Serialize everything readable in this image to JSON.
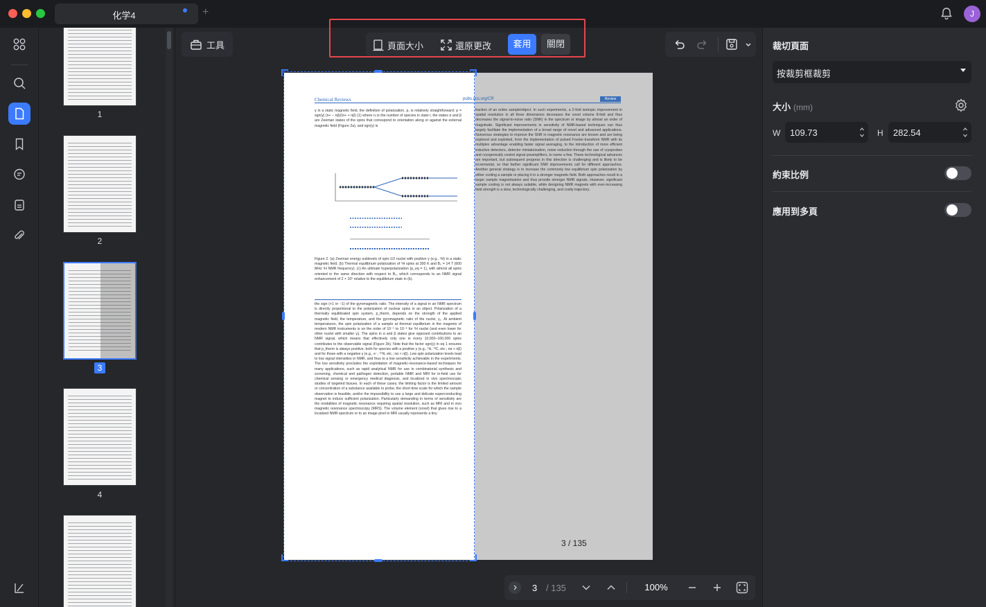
{
  "window": {
    "tab_title": "化学4",
    "tab_add": "+",
    "avatar_initial": "J"
  },
  "thumbnails": [
    {
      "label": "1",
      "selected": false
    },
    {
      "label": "2",
      "selected": false
    },
    {
      "label": "3",
      "selected": true
    },
    {
      "label": "4",
      "selected": false
    },
    {
      "label": "",
      "selected": false
    }
  ],
  "toolbar": {
    "tools_label": "工具",
    "page_size_label": "頁面大小",
    "reset_label": "還原更改",
    "apply_label": "套用",
    "close_label": "關閉"
  },
  "document": {
    "journal_name": "Chemical Reviews",
    "journal_url": "pubs.acs.org/CR",
    "badge": "Review",
    "figure_caption": "Figure 2. (a) Zeeman energy sublevels of spin-1/2 nuclei with positive γ (e.g., ¹H) in a static magnetic field. (b) Thermal equilibrium polarization of ¹H spins at 300 K and B₀ = 14 T (600 MHz ¹H NMR frequency). (c) An ultimate hyperpolarization (p_eq = 1), with almost all spins oriented in the same direction with respect to B₀, which corresponds to an NMR signal enhancement of 2 × 10⁵ relative to the equilibrium state in (b).",
    "left_col_1": "γ in a static magnetic field, the definition of polarization, p, is relatively straightforward: p = sgn(γ) (n+ − nβ)/(n+ + nβ) (1) where nᵢ is the number of species in state i; the states α and β are Zeeman states of the spins that correspond to orientation along or against the external magnetic field (Figure 2a), and sgn(γ) is",
    "left_col_2": "the sign (+1 or −1) of the gyromagnetic ratio. The intensity of a signal in an NMR spectrum is directly proportional to the polarization of nuclear spins in an object. Polarization of a thermally equilibrated spin system, p_therm, depends on the strength of the applied magnetic field, the temperature, and the gyromagnetic ratio of the nuclei, γ₁. At ambient temperatures, the spin polarization of a sample at thermal equilibrium in the magnets of modern NMR instruments is on the order of 10⁻⁵ to 10⁻⁶ for ¹H nuclei (and even lower for other nuclei with smaller γᵢ). The spins in α and β states give opposed contributions to an NMR signal, which means that effectively only one in every 10,000−100,000 spins contributes to the observable signal (Figure 2b). Note that the factor sgn(γ) in eq 1 ensures that p_therm is always positive, both for species with a positive γ (e.g., ¹H, ¹³C, etc.; nα > nβ) and for those with a negative γ (e.g., e⁻, ¹⁵N, etc.; nα < nβ). Low spin polarization levels lead to low signal intensities in NMR, and thus to a low sensitivity achievable in the experiments. The low sensitivity precludes the exploitation of magnetic-resonance-based techniques for many applications, such as rapid analytical NMR for use in combinatorial synthesis and screening, chemical and pathogen detection, portable NMR and MRI for in-field use for chemical sensing or emergency medical diagnosis, and localized in vivo spectroscopic studies of targeted tissues. In each of these cases, the limiting factor is the limited amount or concentration of a substance available to probe, the short time scale for which the sample observation is feasible, and/or the impossibility to use a large and delicate superconducting magnet to induce sufficient polarization. Particularly demanding in terms of sensitivity are the modalities of magnetic resonance requiring spatial resolution, such as MRI and in vivo magnetic resonance spectroscopy (MRS). The volume element (voxel) that gives rise to a localized NMR spectrum or to an image pixel in MRI usually represents a tiny",
    "right_col": "fraction of an entire sample/object. In such experiments, a 2-fold isotropic improvement in spatial resolution in all three dimensions decreases the voxel volume 8-fold and thus decreases the signal-to-noise ratio (SNR) in the spectrum or image by almost an order of magnitude. Significant improvements in sensitivity of NMR-based techniques can thus largely facilitate the implementation of a broad range of novel and advanced applications. Numerous strategies to improve the SNR in magnetic resonance are known and are being explored and exploited, from the implementation of pulsed Fourier-transform NMR with its multiplex advantage enabling faster signal averaging, to the introduction of more efficient inductive detectors, detector miniaturization, noise reduction through the use of cryoprobes and cryogenically cooled signal preamplifiers, to name a few. These technological advances are important, but subsequent progress in this direction is challenging and is likely to be incremental, so that farther significant SNR improvements call for different approaches. Another general strategy is to increase the commonly low equilibrium spin polarization by either cooling a sample or placing it in a stronger magnetic field. Both approaches result in a larger sample magnetization and thus provide stronger NMR signals. However, significant sample cooling is not always suitable, while designing NMR magnets with ever-increasing field strength is a slow, technologically challenging, and costly trajectory.",
    "page_indicator": "3 / 135"
  },
  "nav": {
    "current_page": "3",
    "total_pages": "/ 135",
    "zoom": "100%"
  },
  "panel": {
    "title": "裁切頁面",
    "mode_select": "按裁剪框裁剪",
    "size_label": "大小",
    "size_unit": "(mm)",
    "w_label": "W",
    "h_label": "H",
    "w_value": "109.73",
    "h_value": "282.54",
    "constrain_label": "約束比例",
    "apply_multi_label": "應用到多頁",
    "constrain_on": false,
    "apply_multi_on": false
  },
  "colors": {
    "accent": "#3c7bff",
    "highlight_border": "#e6464d"
  }
}
